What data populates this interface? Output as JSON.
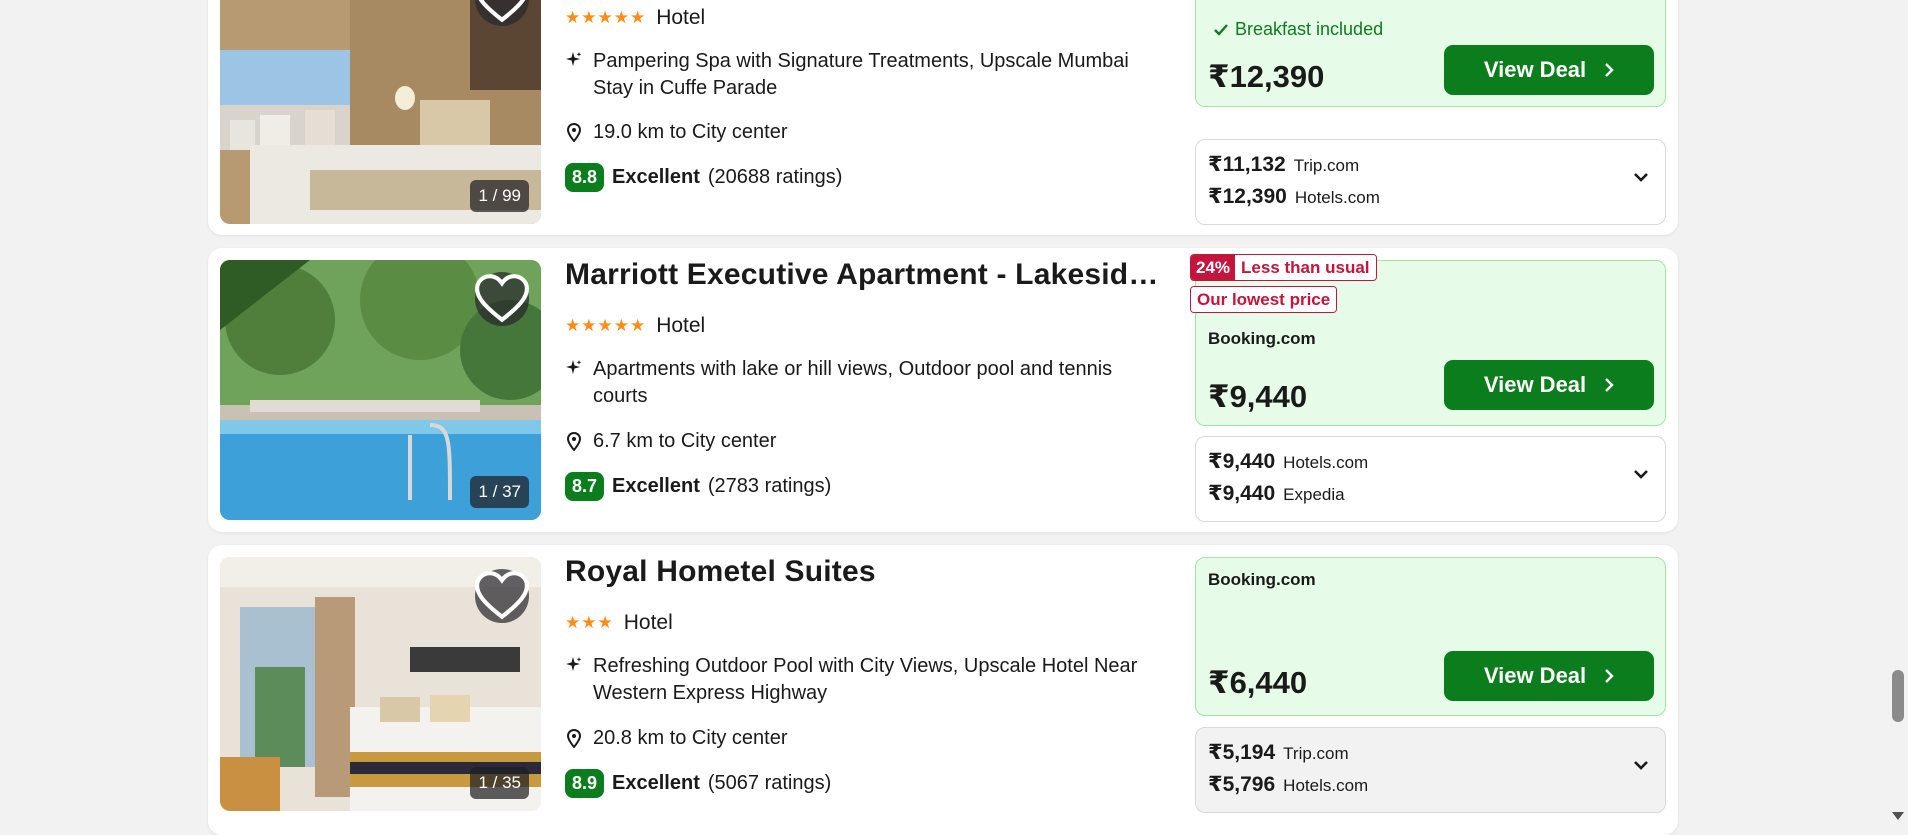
{
  "hotels": [
    {
      "title": "",
      "stars": "★★★★★",
      "type": "Hotel",
      "feature": "Pampering Spa with Signature Treatments, Upscale Mumbai Stay in Cuffe Parade",
      "distance": "19.0 km to City center",
      "score": "8.8",
      "rating_word": "Excellent",
      "ratings_count": "(20688 ratings)",
      "photo_counter": "1 / 99",
      "breakfast": "Breakfast included",
      "deal_price": "₹12,390",
      "view_deal": "View Deal",
      "other_prices": [
        {
          "price": "₹11,132",
          "site": "Trip.com"
        },
        {
          "price": "₹12,390",
          "site": "Hotels.com"
        }
      ]
    },
    {
      "title": "Marriott Executive Apartment - Lakeside Chalet",
      "stars": "★★★★★",
      "type": "Hotel",
      "feature": "Apartments with lake or hill views, Outdoor pool and tennis courts",
      "distance": "6.7 km to City center",
      "score": "8.7",
      "rating_word": "Excellent",
      "ratings_count": "(2783 ratings)",
      "photo_counter": "1 / 37",
      "tag_pct": "24%",
      "tag_less": "Less than usual",
      "tag_lowest": "Our lowest price",
      "deal_provider": "Booking.com",
      "deal_price": "₹9,440",
      "view_deal": "View Deal",
      "other_prices": [
        {
          "price": "₹9,440",
          "site": "Hotels.com"
        },
        {
          "price": "₹9,440",
          "site": "Expedia"
        }
      ]
    },
    {
      "title": "Royal Hometel Suites",
      "stars": "★★★",
      "type": "Hotel",
      "feature": "Refreshing Outdoor Pool with City Views, Upscale Hotel Near Western Express Highway",
      "distance": "20.8 km to City center",
      "score": "8.9",
      "rating_word": "Excellent",
      "ratings_count": "(5067 ratings)",
      "photo_counter": "1 / 35",
      "deal_provider": "Booking.com",
      "deal_price": "₹6,440",
      "view_deal": "View Deal",
      "other_prices": [
        {
          "price": "₹5,194",
          "site": "Trip.com"
        },
        {
          "price": "₹5,796",
          "site": "Hotels.com"
        }
      ]
    }
  ],
  "colors": {
    "deal_green": "#0b7d1c",
    "deal_bg": "#e6fce8",
    "tag_red": "#c4153c",
    "star_orange": "#ff8c1a"
  }
}
